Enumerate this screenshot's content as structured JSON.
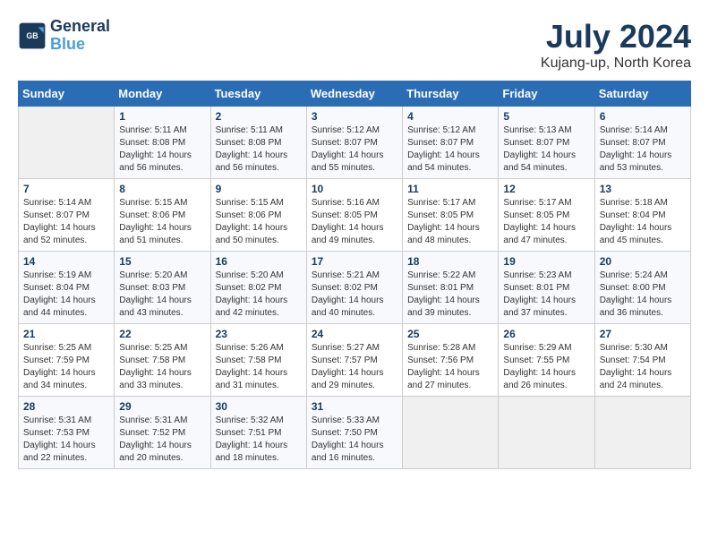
{
  "logo": {
    "text_general": "General",
    "text_blue": "Blue"
  },
  "title": "July 2024",
  "subtitle": "Kujang-up, North Korea",
  "days_of_week": [
    "Sunday",
    "Monday",
    "Tuesday",
    "Wednesday",
    "Thursday",
    "Friday",
    "Saturday"
  ],
  "weeks": [
    [
      {
        "day": "",
        "info": ""
      },
      {
        "day": "1",
        "info": "Sunrise: 5:11 AM\nSunset: 8:08 PM\nDaylight: 14 hours\nand 56 minutes."
      },
      {
        "day": "2",
        "info": "Sunrise: 5:11 AM\nSunset: 8:08 PM\nDaylight: 14 hours\nand 56 minutes."
      },
      {
        "day": "3",
        "info": "Sunrise: 5:12 AM\nSunset: 8:07 PM\nDaylight: 14 hours\nand 55 minutes."
      },
      {
        "day": "4",
        "info": "Sunrise: 5:12 AM\nSunset: 8:07 PM\nDaylight: 14 hours\nand 54 minutes."
      },
      {
        "day": "5",
        "info": "Sunrise: 5:13 AM\nSunset: 8:07 PM\nDaylight: 14 hours\nand 54 minutes."
      },
      {
        "day": "6",
        "info": "Sunrise: 5:14 AM\nSunset: 8:07 PM\nDaylight: 14 hours\nand 53 minutes."
      }
    ],
    [
      {
        "day": "7",
        "info": "Sunrise: 5:14 AM\nSunset: 8:07 PM\nDaylight: 14 hours\nand 52 minutes."
      },
      {
        "day": "8",
        "info": "Sunrise: 5:15 AM\nSunset: 8:06 PM\nDaylight: 14 hours\nand 51 minutes."
      },
      {
        "day": "9",
        "info": "Sunrise: 5:15 AM\nSunset: 8:06 PM\nDaylight: 14 hours\nand 50 minutes."
      },
      {
        "day": "10",
        "info": "Sunrise: 5:16 AM\nSunset: 8:05 PM\nDaylight: 14 hours\nand 49 minutes."
      },
      {
        "day": "11",
        "info": "Sunrise: 5:17 AM\nSunset: 8:05 PM\nDaylight: 14 hours\nand 48 minutes."
      },
      {
        "day": "12",
        "info": "Sunrise: 5:17 AM\nSunset: 8:05 PM\nDaylight: 14 hours\nand 47 minutes."
      },
      {
        "day": "13",
        "info": "Sunrise: 5:18 AM\nSunset: 8:04 PM\nDaylight: 14 hours\nand 45 minutes."
      }
    ],
    [
      {
        "day": "14",
        "info": "Sunrise: 5:19 AM\nSunset: 8:04 PM\nDaylight: 14 hours\nand 44 minutes."
      },
      {
        "day": "15",
        "info": "Sunrise: 5:20 AM\nSunset: 8:03 PM\nDaylight: 14 hours\nand 43 minutes."
      },
      {
        "day": "16",
        "info": "Sunrise: 5:20 AM\nSunset: 8:02 PM\nDaylight: 14 hours\nand 42 minutes."
      },
      {
        "day": "17",
        "info": "Sunrise: 5:21 AM\nSunset: 8:02 PM\nDaylight: 14 hours\nand 40 minutes."
      },
      {
        "day": "18",
        "info": "Sunrise: 5:22 AM\nSunset: 8:01 PM\nDaylight: 14 hours\nand 39 minutes."
      },
      {
        "day": "19",
        "info": "Sunrise: 5:23 AM\nSunset: 8:01 PM\nDaylight: 14 hours\nand 37 minutes."
      },
      {
        "day": "20",
        "info": "Sunrise: 5:24 AM\nSunset: 8:00 PM\nDaylight: 14 hours\nand 36 minutes."
      }
    ],
    [
      {
        "day": "21",
        "info": "Sunrise: 5:25 AM\nSunset: 7:59 PM\nDaylight: 14 hours\nand 34 minutes."
      },
      {
        "day": "22",
        "info": "Sunrise: 5:25 AM\nSunset: 7:58 PM\nDaylight: 14 hours\nand 33 minutes."
      },
      {
        "day": "23",
        "info": "Sunrise: 5:26 AM\nSunset: 7:58 PM\nDaylight: 14 hours\nand 31 minutes."
      },
      {
        "day": "24",
        "info": "Sunrise: 5:27 AM\nSunset: 7:57 PM\nDaylight: 14 hours\nand 29 minutes."
      },
      {
        "day": "25",
        "info": "Sunrise: 5:28 AM\nSunset: 7:56 PM\nDaylight: 14 hours\nand 27 minutes."
      },
      {
        "day": "26",
        "info": "Sunrise: 5:29 AM\nSunset: 7:55 PM\nDaylight: 14 hours\nand 26 minutes."
      },
      {
        "day": "27",
        "info": "Sunrise: 5:30 AM\nSunset: 7:54 PM\nDaylight: 14 hours\nand 24 minutes."
      }
    ],
    [
      {
        "day": "28",
        "info": "Sunrise: 5:31 AM\nSunset: 7:53 PM\nDaylight: 14 hours\nand 22 minutes."
      },
      {
        "day": "29",
        "info": "Sunrise: 5:31 AM\nSunset: 7:52 PM\nDaylight: 14 hours\nand 20 minutes."
      },
      {
        "day": "30",
        "info": "Sunrise: 5:32 AM\nSunset: 7:51 PM\nDaylight: 14 hours\nand 18 minutes."
      },
      {
        "day": "31",
        "info": "Sunrise: 5:33 AM\nSunset: 7:50 PM\nDaylight: 14 hours\nand 16 minutes."
      },
      {
        "day": "",
        "info": ""
      },
      {
        "day": "",
        "info": ""
      },
      {
        "day": "",
        "info": ""
      }
    ]
  ]
}
